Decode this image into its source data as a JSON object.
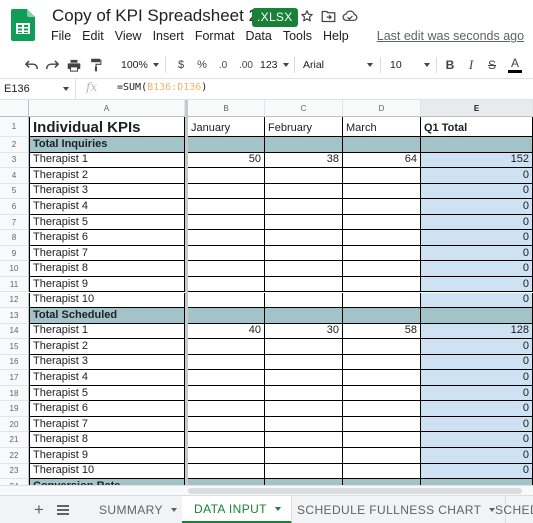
{
  "doc": {
    "title": "Copy of KPI Spreadsheet 2023",
    "badge": ".XLSX",
    "last_edit": "Last edit was seconds ago"
  },
  "menu": [
    "File",
    "Edit",
    "View",
    "Insert",
    "Format",
    "Data",
    "Tools",
    "Help"
  ],
  "toolbar": {
    "zoom": "100%",
    "currency": "$",
    "percent": "%",
    "decrease_decimals": ".0",
    "increase_decimals": ".00",
    "more_formats": "123",
    "font": "Arial",
    "font_size": "10",
    "bold": "B",
    "italic": "I",
    "strikethrough": "S",
    "text_color": "A"
  },
  "formula_bar": {
    "cell_ref": "E136",
    "fx": "fx",
    "formula_prefix": "=SUM(",
    "formula_range": "B136:D136",
    "formula_suffix": ")"
  },
  "columns": [
    "A",
    "B",
    "C",
    "D",
    "E"
  ],
  "rows": [
    {
      "n": "1",
      "a": "Individual KPIs",
      "b": "January",
      "c": "February",
      "d": "March",
      "e": "Q1 Total",
      "type": "title"
    },
    {
      "n": "2",
      "a": "Total Inquiries",
      "b": "",
      "c": "",
      "d": "",
      "e": "",
      "type": "section"
    },
    {
      "n": "3",
      "a": "Therapist 1",
      "b": "50",
      "c": "38",
      "d": "64",
      "e": "152",
      "type": "data"
    },
    {
      "n": "4",
      "a": "Therapist 2",
      "b": "",
      "c": "",
      "d": "",
      "e": "0",
      "type": "data"
    },
    {
      "n": "5",
      "a": "Therapist 3",
      "b": "",
      "c": "",
      "d": "",
      "e": "0",
      "type": "data"
    },
    {
      "n": "6",
      "a": "Therapist 4",
      "b": "",
      "c": "",
      "d": "",
      "e": "0",
      "type": "data"
    },
    {
      "n": "7",
      "a": "Therapist 5",
      "b": "",
      "c": "",
      "d": "",
      "e": "0",
      "type": "data"
    },
    {
      "n": "8",
      "a": "Therapist 6",
      "b": "",
      "c": "",
      "d": "",
      "e": "0",
      "type": "data"
    },
    {
      "n": "9",
      "a": "Therapist 7",
      "b": "",
      "c": "",
      "d": "",
      "e": "0",
      "type": "data"
    },
    {
      "n": "10",
      "a": "Therapist 8",
      "b": "",
      "c": "",
      "d": "",
      "e": "0",
      "type": "data"
    },
    {
      "n": "11",
      "a": "Therapist 9",
      "b": "",
      "c": "",
      "d": "",
      "e": "0",
      "type": "data"
    },
    {
      "n": "12",
      "a": "Therapist 10",
      "b": "",
      "c": "",
      "d": "",
      "e": "0",
      "type": "data"
    },
    {
      "n": "13",
      "a": "Total Scheduled",
      "b": "",
      "c": "",
      "d": "",
      "e": "",
      "type": "section"
    },
    {
      "n": "14",
      "a": "Therapist 1",
      "b": "40",
      "c": "30",
      "d": "58",
      "e": "128",
      "type": "data"
    },
    {
      "n": "15",
      "a": "Therapist 2",
      "b": "",
      "c": "",
      "d": "",
      "e": "0",
      "type": "data"
    },
    {
      "n": "16",
      "a": "Therapist 3",
      "b": "",
      "c": "",
      "d": "",
      "e": "0",
      "type": "data"
    },
    {
      "n": "17",
      "a": "Therapist 4",
      "b": "",
      "c": "",
      "d": "",
      "e": "0",
      "type": "data"
    },
    {
      "n": "18",
      "a": "Therapist 5",
      "b": "",
      "c": "",
      "d": "",
      "e": "0",
      "type": "data"
    },
    {
      "n": "19",
      "a": "Therapist 6",
      "b": "",
      "c": "",
      "d": "",
      "e": "0",
      "type": "data"
    },
    {
      "n": "20",
      "a": "Therapist 7",
      "b": "",
      "c": "",
      "d": "",
      "e": "0",
      "type": "data"
    },
    {
      "n": "21",
      "a": "Therapist 8",
      "b": "",
      "c": "",
      "d": "",
      "e": "0",
      "type": "data"
    },
    {
      "n": "22",
      "a": "Therapist 9",
      "b": "",
      "c": "",
      "d": "",
      "e": "0",
      "type": "data"
    },
    {
      "n": "23",
      "a": "Therapist 10",
      "b": "",
      "c": "",
      "d": "",
      "e": "0",
      "type": "data"
    },
    {
      "n": "24",
      "a": "Conversion Rate",
      "b": "",
      "c": "",
      "d": "",
      "e": "",
      "type": "section"
    }
  ],
  "sheet_tabs": [
    {
      "label": "SUMMARY",
      "active": false
    },
    {
      "label": "DATA INPUT",
      "active": true
    },
    {
      "label": "SCHEDULE FULLNESS CHART",
      "active": false
    },
    {
      "label": "SCHED",
      "active": false
    }
  ],
  "colors": {
    "brand_green": "#188038",
    "section_teal": "#a2c4c9",
    "total_light_blue": "#cfe2f3"
  }
}
